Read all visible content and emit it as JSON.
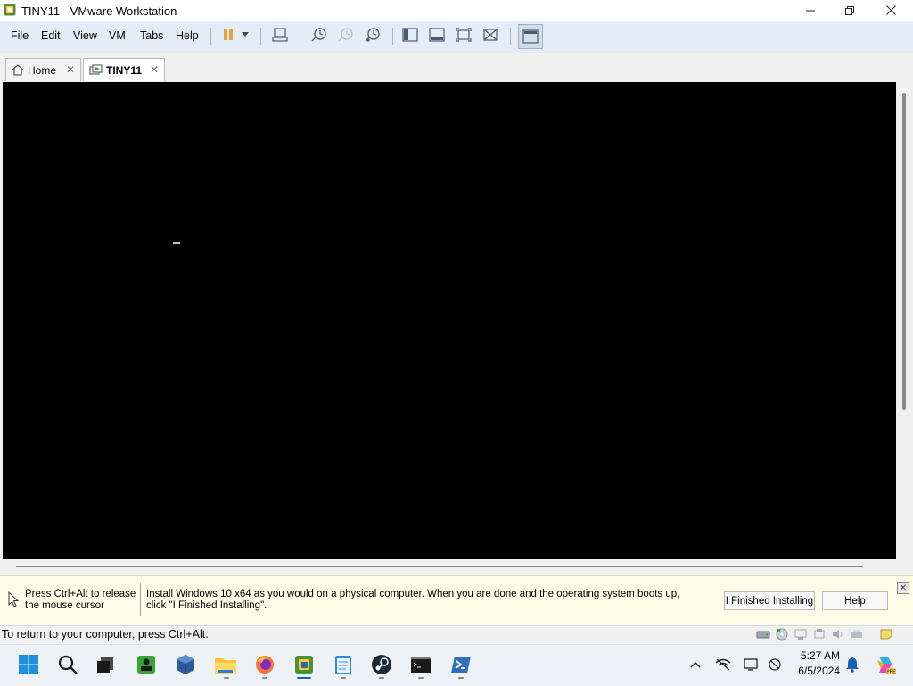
{
  "window": {
    "title": "TINY11 - VMware Workstation",
    "controls": [
      "minimize",
      "maximize",
      "close"
    ]
  },
  "menu": {
    "items": [
      "File",
      "Edit",
      "View",
      "VM",
      "Tabs",
      "Help"
    ]
  },
  "toolbar": {
    "icons": [
      "pause-icon",
      "dropdown-icon",
      "send-ctrl-alt-del-icon",
      "snapshot-take-icon",
      "snapshot-revert-icon",
      "snapshot-manager-icon",
      "library-icon",
      "thumbnail-bar-icon",
      "fullscreen-icon",
      "unity-icon",
      "console-view-icon"
    ]
  },
  "tabs": [
    {
      "label": "Home",
      "active": false
    },
    {
      "label": "TINY11",
      "active": true
    }
  ],
  "hint": {
    "release_text": "Press Ctrl+Alt to release the mouse cursor",
    "message": "Install Windows 10 x64 as you would on a physical computer. When you are done and the operating system boots up, click \"I Finished Installing\".",
    "finished_button": "I Finished Installing",
    "help_button": "Help"
  },
  "status": {
    "text": "To return to your computer, press Ctrl+Alt."
  },
  "taskbar": {
    "apps": [
      "start-icon",
      "search-icon",
      "task-view-icon",
      "app-green-icon",
      "virtualbox-icon",
      "file-explorer-icon",
      "firefox-icon",
      "vmware-icon",
      "notepad-icon",
      "steam-icon",
      "terminal-icon",
      "powershell-icon"
    ],
    "time": "5:27 AM",
    "date": "6/5/2024"
  },
  "colors": {
    "vm_screen": "#000000",
    "hint_bg": "#fffce7",
    "accent": "#0067c0"
  }
}
